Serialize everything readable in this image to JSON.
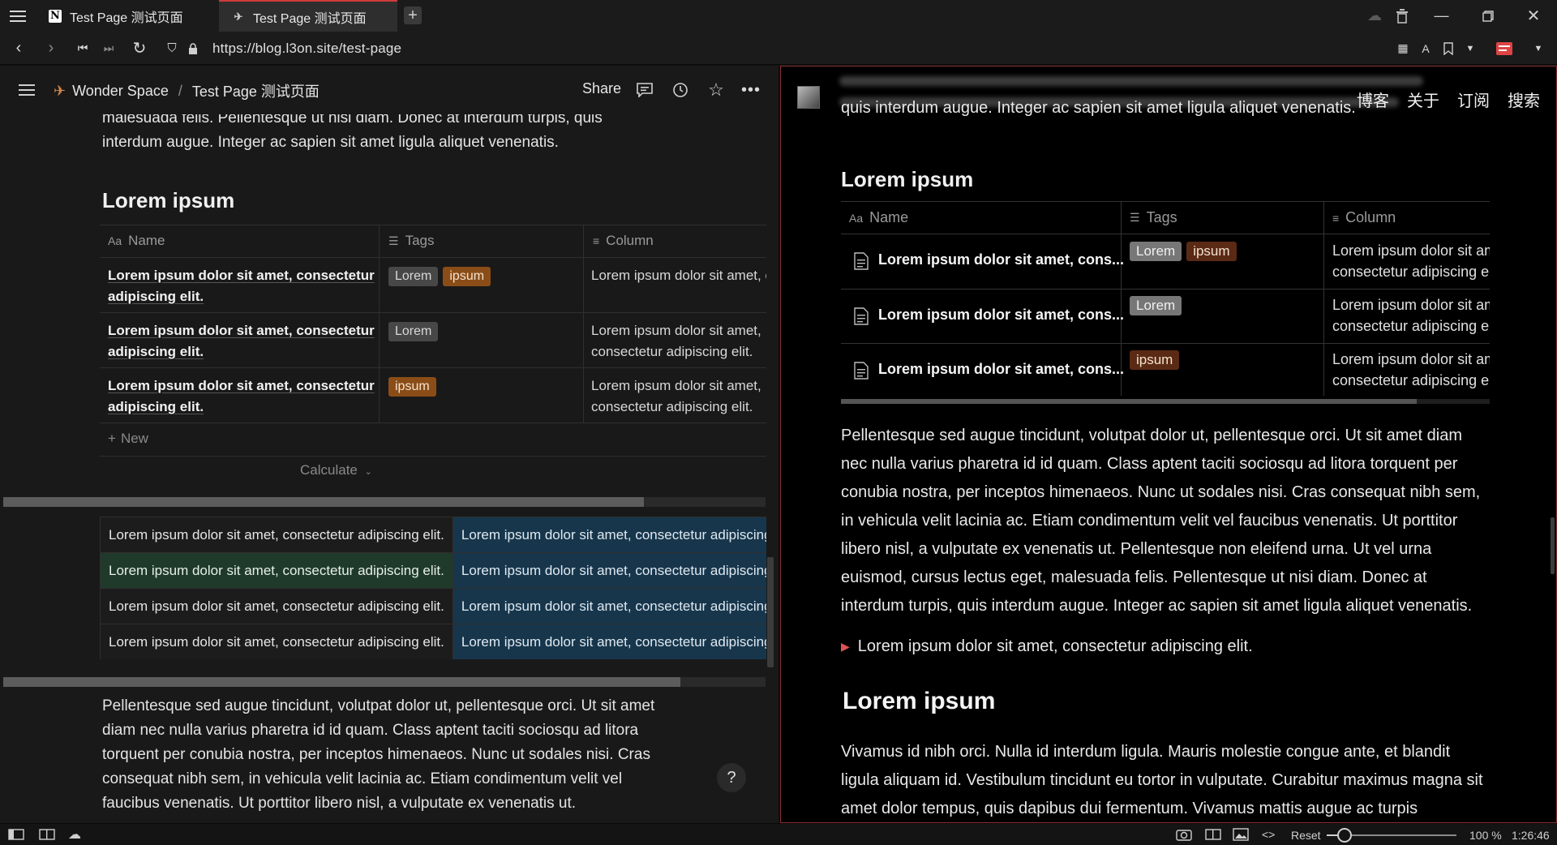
{
  "browser": {
    "tabs": [
      {
        "title": "Test Page 测试页面",
        "active": false
      },
      {
        "title": "Test Page 测试页面",
        "active": true
      }
    ],
    "url": "https://blog.l3on.site/test-page"
  },
  "notion": {
    "breadcrumb": [
      "Wonder Space",
      "Test Page 测试页面"
    ],
    "share_label": "Share",
    "intro_text": "Pellentesque non eleifend urna. Ut vel urna euismod, cursus lectus eget, malesuada felis. Pellentesque ut nisi diam. Donec at interdum turpis, quis interdum augue. Integer ac sapien sit amet ligula aliquet venenatis.",
    "heading1": "Lorem ipsum",
    "db_headers": [
      "Name",
      "Tags",
      "Column"
    ],
    "db_rows": [
      {
        "name": "Lorem ipsum dolor sit amet, consectetur adipiscing elit.",
        "tags": [
          "Lorem",
          "ipsum"
        ],
        "column": "Lorem ipsum dolor sit amet, consectetur adipiscing elit."
      },
      {
        "name": "Lorem ipsum dolor sit amet, consectetur adipiscing elit.",
        "tags": [
          "Lorem"
        ],
        "column": "Lorem ipsum dolor sit amet, consectetur adipiscing elit."
      },
      {
        "name": "Lorem ipsum dolor sit amet, consectetur adipiscing elit.",
        "tags": [
          "ipsum"
        ],
        "column": "Lorem ipsum dolor sit amet, consectetur adipiscing elit."
      }
    ],
    "new_label": "New",
    "calculate_label": "Calculate",
    "simple_table": [
      [
        "Lorem ipsum dolor sit amet, consectetur adipiscing elit.",
        "Lorem ipsum dolor sit amet, consectetur adipiscing elit."
      ],
      [
        "Lorem ipsum dolor sit amet, consectetur adipiscing elit.",
        "Lorem ipsum dolor sit amet, consectetur adipiscing elit."
      ],
      [
        "Lorem ipsum dolor sit amet, consectetur adipiscing elit.",
        "Lorem ipsum dolor sit amet, consectetur adipiscing elit."
      ],
      [
        "Lorem ipsum dolor sit amet, consectetur adipiscing elit.",
        "Lorem ipsum dolor sit amet, consectetur adipiscing elit."
      ]
    ],
    "para2": "Pellentesque sed augue tincidunt, volutpat dolor ut, pellentesque orci. Ut sit amet diam nec nulla varius pharetra id id quam. Class aptent taciti sociosqu ad litora torquent per conubia nostra, per inceptos himenaeos. Nunc ut sodales nisi. Cras consequat nibh sem, in vehicula velit lacinia ac. Etiam condimentum velit vel faucibus venenatis. Ut porttitor libero nisl, a vulputate ex venenatis ut.",
    "help_label": "?"
  },
  "blog": {
    "nav": [
      "博客",
      "关于",
      "订阅",
      "搜索"
    ],
    "top_text": "quis interdum augue. Integer ac sapien sit amet ligula aliquet venenatis.",
    "heading1": "Lorem ipsum",
    "db_headers": [
      "Name",
      "Tags",
      "Column"
    ],
    "db_rows": [
      {
        "name": "Lorem ipsum dolor sit amet, cons...",
        "tags": [
          "Lorem",
          "ipsum"
        ],
        "column": [
          "Lorem ipsum dolor sit am",
          "consectetur adipiscing eli"
        ]
      },
      {
        "name": "Lorem ipsum dolor sit amet, cons...",
        "tags": [
          "Lorem"
        ],
        "column": [
          "Lorem ipsum dolor sit am",
          "consectetur adipiscing eli"
        ]
      },
      {
        "name": "Lorem ipsum dolor sit amet, cons...",
        "tags": [
          "ipsum"
        ],
        "column": [
          "Lorem ipsum dolor sit am",
          "consectetur adipiscing eli"
        ]
      }
    ],
    "para": "Pellentesque sed augue tincidunt, volutpat dolor ut, pellentesque orci. Ut sit amet diam nec nulla varius pharetra id id quam. Class aptent taciti sociosqu ad litora torquent per conubia nostra, per inceptos himenaeos. Nunc ut sodales nisi. Cras consequat nibh sem, in vehicula velit lacinia ac. Etiam condimentum velit vel faucibus venenatis. Ut porttitor libero nisl, a vulputate ex venenatis ut. Pellentesque non eleifend urna. Ut vel urna euismod, cursus lectus eget, malesuada felis. Pellentesque ut nisi diam. Donec at interdum turpis, quis interdum augue. Integer ac sapien sit amet ligula aliquet venenatis.",
    "toggle": "Lorem ipsum dolor sit amet, consectetur adipiscing elit.",
    "heading2": "Lorem ipsum",
    "para3": "Vivamus id nibh orci. Nulla id interdum ligula. Mauris molestie congue ante, et blandit ligula aliquam id. Vestibulum tincidunt eu tortor in vulputate. Curabitur maximus magna sit amet dolor tempus, quis dapibus dui fermentum. Vivamus mattis augue ac turpis"
  },
  "statusbar": {
    "reset_label": "Reset",
    "zoom": "100 %",
    "zoom_fraction": 0.14,
    "clock": "1:26:46"
  },
  "colors": {
    "tab_accent": "#cf3b3b",
    "tag_orange": "#8a4d17",
    "tag_gray": "#474747",
    "table_green": "#1f3a2a",
    "table_blue": "#17364c",
    "blog_tag_gray": "#777777",
    "blog_tag_brown": "#5a2a14"
  }
}
